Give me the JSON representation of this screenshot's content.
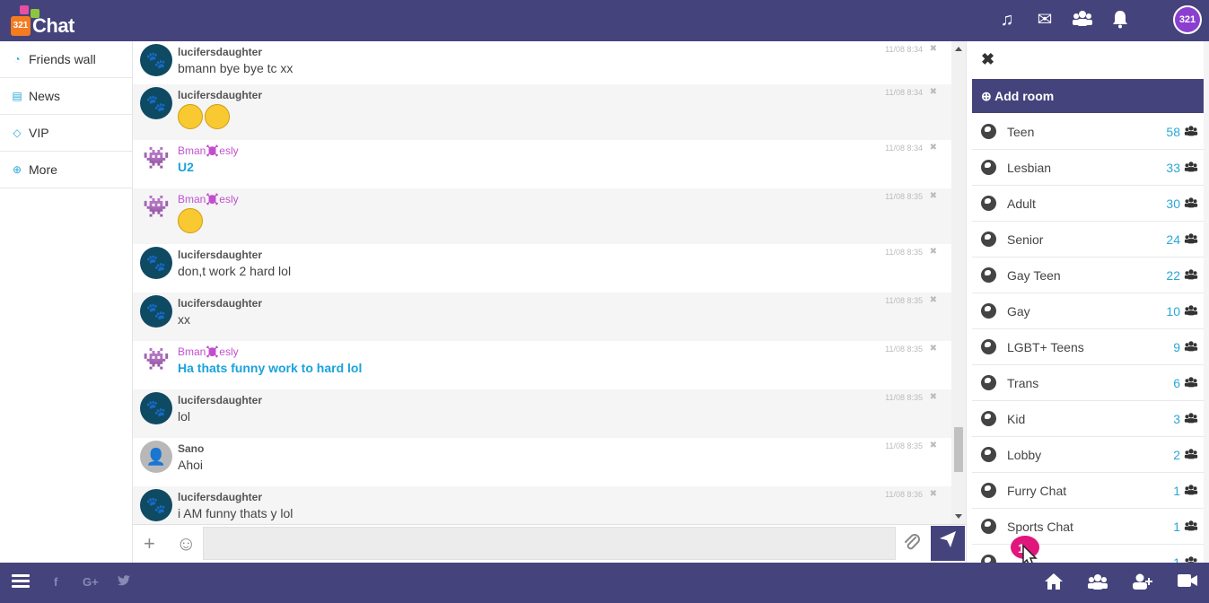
{
  "brand": {
    "logo_badge": "321",
    "logo_word": "Chat",
    "avatar_text": "321"
  },
  "topbar_icons": [
    "music-icon",
    "envelope-icon",
    "users-icon",
    "bell-icon"
  ],
  "left_nav": [
    {
      "label": "Friends wall",
      "icon": "rss-icon"
    },
    {
      "label": "News",
      "icon": "newspaper-icon"
    },
    {
      "label": "VIP",
      "icon": "diamond-icon"
    },
    {
      "label": "More",
      "icon": "plus-circle-icon"
    }
  ],
  "messages": [
    {
      "user": "lucifersdaughter",
      "text": "bmann bye bye tc xx",
      "time": "11/08 8:34",
      "avatar": "paw",
      "vip": false,
      "blue": false
    },
    {
      "user": "lucifersdaughter",
      "text": "",
      "emoji": [
        "laughing",
        "kiss"
      ],
      "time": "11/08 8:34",
      "avatar": "paw",
      "vip": false,
      "blue": false
    },
    {
      "user": "Bman☠️esly",
      "text": "U2",
      "time": "11/08 8:34",
      "avatar": "devil",
      "vip": true,
      "blue": true
    },
    {
      "user": "Bman☠️esly",
      "text": "",
      "emoji": [
        "smile"
      ],
      "time": "11/08 8:35",
      "avatar": "devil",
      "vip": true,
      "blue": false
    },
    {
      "user": "lucifersdaughter",
      "text": "don,t work 2 hard lol",
      "time": "11/08 8:35",
      "avatar": "paw",
      "vip": false,
      "blue": false
    },
    {
      "user": "lucifersdaughter",
      "text": "xx",
      "time": "11/08 8:35",
      "avatar": "paw",
      "vip": false,
      "blue": false
    },
    {
      "user": "Bman☠️esly",
      "text": "Ha thats funny work to hard lol",
      "time": "11/08 8:35",
      "avatar": "devil",
      "vip": true,
      "blue": true
    },
    {
      "user": "lucifersdaughter",
      "text": "lol",
      "time": "11/08 8:35",
      "avatar": "paw",
      "vip": false,
      "blue": false
    },
    {
      "user": "Sano",
      "text": "Ahoi",
      "time": "11/08 8:35",
      "avatar": "grey",
      "vip": false,
      "blue": false
    },
    {
      "user": "lucifersdaughter",
      "text": "i AM funny thats y lol",
      "time": "11/08 8:36",
      "avatar": "paw",
      "vip": false,
      "blue": false
    }
  ],
  "input": {
    "placeholder": "",
    "value": ""
  },
  "rooms_panel": {
    "add_room_label": "Add room",
    "rooms": [
      {
        "name": "Teen",
        "count": "58"
      },
      {
        "name": "Lesbian",
        "count": "33"
      },
      {
        "name": "Adult",
        "count": "30"
      },
      {
        "name": "Senior",
        "count": "24"
      },
      {
        "name": "Gay Teen",
        "count": "22"
      },
      {
        "name": "Gay",
        "count": "10"
      },
      {
        "name": "LGBT+ Teens",
        "count": "9"
      },
      {
        "name": "Trans",
        "count": "6"
      },
      {
        "name": "Kid",
        "count": "3"
      },
      {
        "name": "Lobby",
        "count": "2"
      },
      {
        "name": "Furry Chat",
        "count": "1"
      },
      {
        "name": "Sports Chat",
        "count": "1"
      },
      {
        "name": "",
        "count": "1"
      }
    ]
  },
  "footer": {
    "social": [
      "f",
      "G+",
      "twitter"
    ],
    "icons": [
      "home-icon",
      "users-icon",
      "add-user-icon",
      "video-icon"
    ]
  },
  "cursor_badge": "1"
}
